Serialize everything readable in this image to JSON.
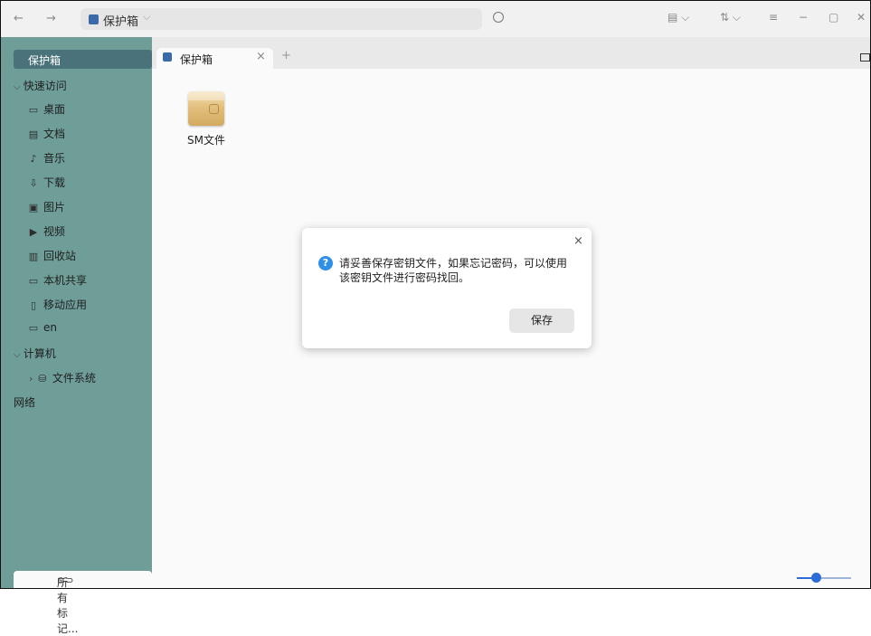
{
  "topbar": {
    "back": "←",
    "forward": "→",
    "breadcrumb": "保护箱",
    "view_mode": "▤ ⌵",
    "sort": "⇅ ⌵",
    "menu": "≡",
    "minimize": "−",
    "maximize": "▢",
    "close": "✕"
  },
  "sidebar": {
    "active": "保护箱",
    "section_quick": "快速访问",
    "quick_items": [
      "桌面",
      "文档",
      "音乐",
      "下载",
      "图片",
      "视频",
      "回收站",
      "本机共享",
      "移动应用",
      "en"
    ],
    "section_computer": "计算机",
    "computer_items": [
      "文件系统"
    ],
    "network": "网络",
    "tags": "所有标记..."
  },
  "tabs": [
    {
      "label": "保护箱",
      "close": "×"
    }
  ],
  "tab_add": "+",
  "content": {
    "files": [
      {
        "name": "SM文件"
      }
    ],
    "zoom_level": 0.35
  },
  "dialog": {
    "message": "请妥善保存密钥文件，如果忘记密码，可以使用该密钥文件进行密码找回。",
    "save_button": "保存",
    "close": "×"
  }
}
